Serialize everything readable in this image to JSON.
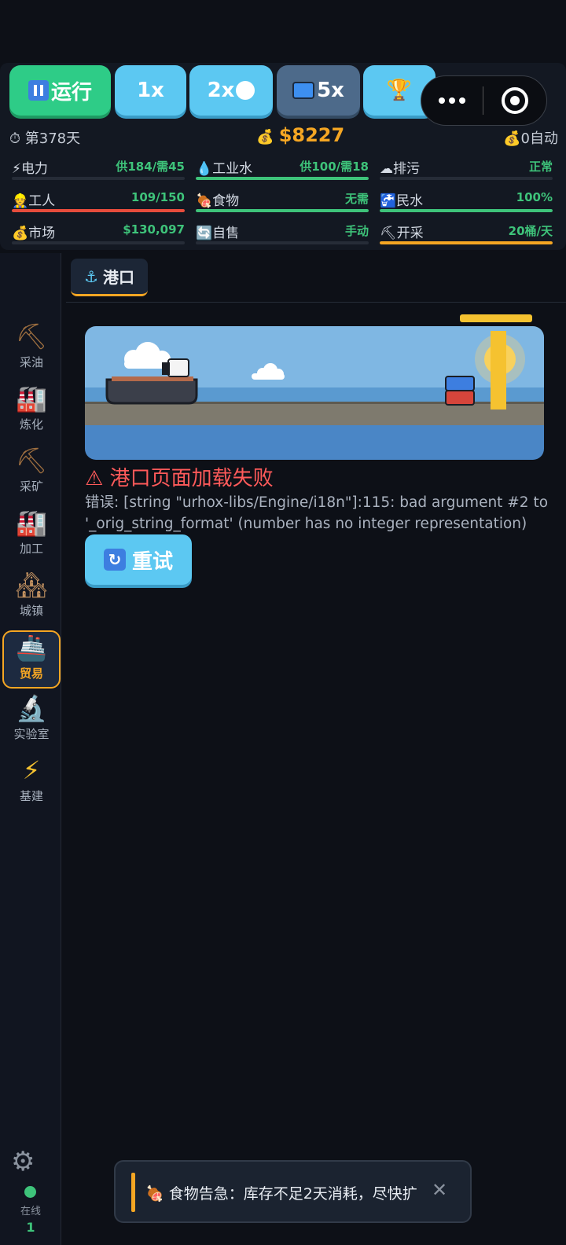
{
  "toolbar": {
    "run_label": "运行",
    "speed_1x": "1x",
    "speed_2x": "2x",
    "speed_5x": "5x",
    "trophy_icon": "trophy-icon"
  },
  "status": {
    "day": "第378天",
    "money": "$8227",
    "auto": "0自动"
  },
  "stats": [
    {
      "label": "电力",
      "icon": "⚡",
      "value": "供184/需45",
      "value_color": "#3ec37a",
      "fill": 0.0,
      "bar_color": "#3ec37a"
    },
    {
      "label": "工业水",
      "icon": "💧",
      "value": "供100/需18",
      "value_color": "#3ec37a",
      "fill": 1.0,
      "bar_color": "#3ec37a"
    },
    {
      "label": "排污",
      "icon": "☁",
      "value": "正常",
      "value_color": "#3ec37a",
      "fill": 0.0,
      "bar_color": "#3ec37a"
    },
    {
      "label": "工人",
      "icon": "👷",
      "value": "109/150",
      "value_color": "#3ec37a",
      "fill": 1.0,
      "bar_color": "#e74c3c"
    },
    {
      "label": "食物",
      "icon": "🍖",
      "value": "无需",
      "value_color": "#3ec37a",
      "fill": 1.0,
      "bar_color": "#3ec37a"
    },
    {
      "label": "民水",
      "icon": "🚰",
      "value": "100%",
      "value_color": "#3ec37a",
      "fill": 1.0,
      "bar_color": "#3ec37a"
    },
    {
      "label": "市场",
      "icon": "💰",
      "value": "$130,097",
      "value_color": "#3ec37a",
      "fill": 0.0,
      "bar_color": "#3ec37a"
    },
    {
      "label": "自售",
      "icon": "🔄",
      "value": "手动",
      "value_color": "#3ec37a",
      "fill": 0.0,
      "bar_color": "#3ec37a"
    },
    {
      "label": "开采",
      "icon": "⛏",
      "value": "20桶/天",
      "value_color": "#3ec37a",
      "fill": 1.0,
      "bar_color": "#f5a623"
    }
  ],
  "sidebar": {
    "items": [
      {
        "label": "采油",
        "icon": "⛏"
      },
      {
        "label": "炼化",
        "icon": "🏭"
      },
      {
        "label": "采矿",
        "icon": "⛏"
      },
      {
        "label": "加工",
        "icon": "🏭"
      },
      {
        "label": "城镇",
        "icon": "🏘"
      },
      {
        "label": "贸易",
        "icon": "🚢"
      },
      {
        "label": "实验室",
        "icon": "🔬"
      },
      {
        "label": "基建",
        "icon": "⚡"
      }
    ],
    "active_index": 5,
    "online_label": "在线",
    "online_count": "1"
  },
  "tab": {
    "label": "港口",
    "icon": "⚓"
  },
  "error": {
    "title": "港口页面加载失败",
    "message": "错误: [string \"urhox-libs/Engine/i18n\"]:115: bad argument #2 to '_orig_string_format' (number has no integer representation)",
    "retry_label": "重试"
  },
  "toast": {
    "message": "🍖 食物告急：库存不足2天消耗，尽快扩",
    "close": "✕"
  }
}
